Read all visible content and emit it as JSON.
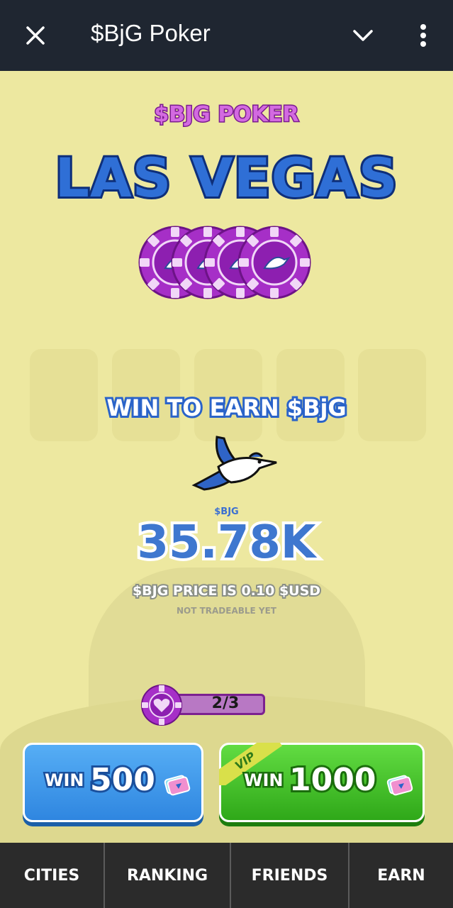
{
  "window": {
    "title": "$BjG Poker"
  },
  "icons": {
    "close": "close-icon",
    "chevron": "chevron-down-icon",
    "more": "more-vertical-icon",
    "chips": "poker-chip-icon",
    "bird": "blue-jay-icon",
    "heart_chip": "heart-chip-icon",
    "ticket": "ticket-icon"
  },
  "game": {
    "brand": "$BJG POKER",
    "city": "LAS VEGAS",
    "earn_banner": "WIN TO EARN $BjG",
    "token_label": "$BJG",
    "balance": "35.78K",
    "price_text": "$BJG PRICE IS 0.10 $USD",
    "note": "NOT TRADEABLE YET",
    "lives": "2/3"
  },
  "buttons": {
    "blue": {
      "win": "WIN",
      "amount": "500"
    },
    "green": {
      "win": "WIN",
      "amount": "1000",
      "badge": "VIP"
    }
  },
  "tabs": [
    {
      "label": "CITIES"
    },
    {
      "label": "RANKING"
    },
    {
      "label": "FRIENDS"
    },
    {
      "label": "EARN"
    }
  ],
  "colors": {
    "topbar": "#1f2631",
    "background": "#ede8a0",
    "brand_purple": "#d36ae0",
    "city_blue": "#2f6fd6",
    "button_blue": "#3b93e8",
    "button_green": "#3fc028",
    "tabbar": "#2b2b2b"
  }
}
